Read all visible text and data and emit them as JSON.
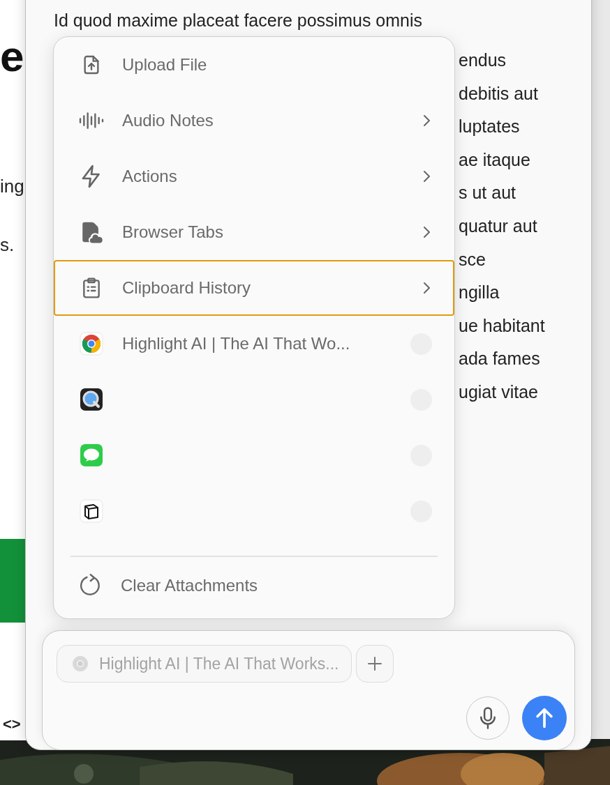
{
  "background_page": {
    "fragments": [
      {
        "kind": "heading",
        "text": "e"
      },
      {
        "kind": "body",
        "text": "ing"
      },
      {
        "kind": "body",
        "text": "s."
      },
      {
        "kind": "code",
        "text": "<>"
      }
    ]
  },
  "document": {
    "lead_line": "Id quod maxime placeat facere possimus omnis",
    "line_ends": [
      "endus",
      "debitis aut",
      "luptates",
      "ae itaque",
      "s ut aut",
      "quatur aut",
      "sce",
      "ngilla",
      "ue habitant",
      "ada fames",
      "ugiat vitae"
    ]
  },
  "menu": {
    "items": [
      {
        "kind": "action",
        "label": "Upload File",
        "has_submenu": false,
        "selected": false
      },
      {
        "kind": "action",
        "label": "Audio Notes",
        "has_submenu": true,
        "selected": false
      },
      {
        "kind": "action",
        "label": "Actions",
        "has_submenu": true,
        "selected": false
      },
      {
        "kind": "action",
        "label": "Browser Tabs",
        "has_submenu": true,
        "selected": false
      },
      {
        "kind": "action",
        "label": "Clipboard History",
        "has_submenu": true,
        "selected": true
      },
      {
        "kind": "app",
        "label": "Highlight AI | The AI That Wo...",
        "checked": false,
        "selected": false
      },
      {
        "kind": "app",
        "checked": false,
        "selected": false
      },
      {
        "kind": "app",
        "checked": false,
        "selected": false
      },
      {
        "kind": "app",
        "checked": false,
        "selected": false
      }
    ],
    "footer": {
      "label": "Clear Attachments"
    }
  },
  "composer": {
    "attachment": "Highlight AI | The AI That Works..."
  }
}
